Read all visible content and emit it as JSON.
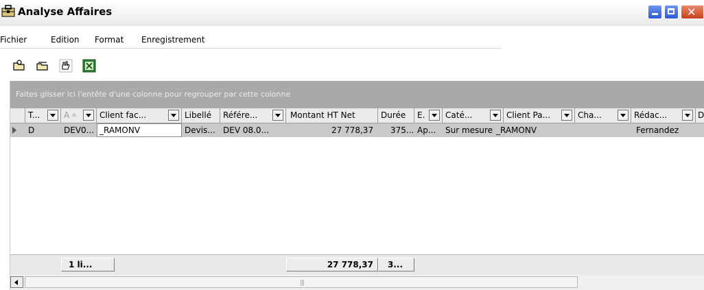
{
  "window": {
    "title": "Analyse Affaires",
    "icon": "briefcase-icon",
    "controls": [
      "minimize-icon",
      "maximize-icon",
      "close-icon"
    ]
  },
  "menu": [
    "Fichier",
    "Edition",
    "Format",
    "Enregistrement"
  ],
  "toolbar": {
    "buttons": [
      "folder-open-icon",
      "folder-icon",
      "hand-tool-icon",
      "excel-export-icon"
    ]
  },
  "grid": {
    "group_hint": "Faites glisser ici l'entête d'une colonne pour regrouper par cette colonne",
    "columns": [
      "T...",
      "A",
      "Client fac...",
      "Libellé",
      "Référe...",
      "Montant HT Net",
      "Durée",
      "E.",
      "Caté...",
      "Client Pa...",
      "Cha...",
      "Rédac...",
      "D"
    ],
    "rows": [
      [
        "D",
        "DEV0...",
        "_RAMONV",
        "Devis...",
        "DEV 08.0...",
        "27 778,37",
        "375...",
        "Ap...",
        "Sur mesure",
        "_RAMONV",
        "",
        "Fernandez",
        ""
      ]
    ],
    "summary": {
      "count": "1 li...",
      "montant": "27 778,37",
      "duree": "3..."
    }
  },
  "colors": {
    "group_panel": "#a9a9a9",
    "selected_row": "#c9c9c9",
    "header_bg": "#ebebeb",
    "title_close": "#c6401c",
    "title_buttons": "#2b5ad6"
  }
}
